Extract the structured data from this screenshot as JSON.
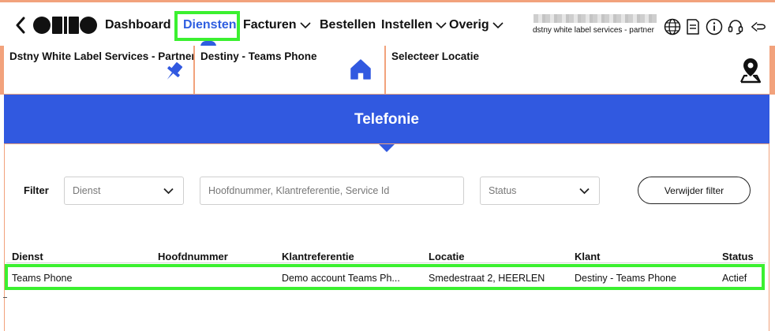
{
  "nav": {
    "logo_text": "ODIDO",
    "items": [
      {
        "label": "Dashboard"
      },
      {
        "label": "Diensten"
      },
      {
        "label": "Facturen"
      },
      {
        "label": "Bestellen"
      },
      {
        "label": "Instellen"
      },
      {
        "label": "Overig"
      }
    ],
    "account_subtitle": "dstny white label services - partner",
    "icons": [
      "globe-icon",
      "document-icon",
      "info-icon",
      "headset-icon",
      "logout-icon"
    ],
    "colors": {
      "accent": "#2f5ee0",
      "highlight": "#3bf030",
      "frame": "#f2a27c"
    }
  },
  "selectors": {
    "partner": "Dstny White Label Services - Partner",
    "customer": "Destiny - Teams Phone",
    "location": "Selecteer Locatie"
  },
  "banner": {
    "title": "Telefonie",
    "color": "#3159e0"
  },
  "filter": {
    "label": "Filter",
    "dienst_placeholder": "Dienst",
    "search_placeholder": "Hoofdnummer, Klantreferentie, Service Id",
    "status_placeholder": "Status",
    "clear_label": "Verwijder filter"
  },
  "table": {
    "headers": {
      "dienst": "Dienst",
      "hoofdnummer": "Hoofdnummer",
      "klantreferentie": "Klantreferentie",
      "locatie": "Locatie",
      "klant": "Klant",
      "status": "Status"
    },
    "rows": [
      {
        "dienst": "Teams Phone",
        "hoofdnummer": "",
        "klantreferentie": "Demo account Teams Ph...",
        "locatie": "Smedestraat 2, HEERLEN",
        "klant": "Destiny - Teams Phone",
        "status": "Actief"
      }
    ]
  }
}
